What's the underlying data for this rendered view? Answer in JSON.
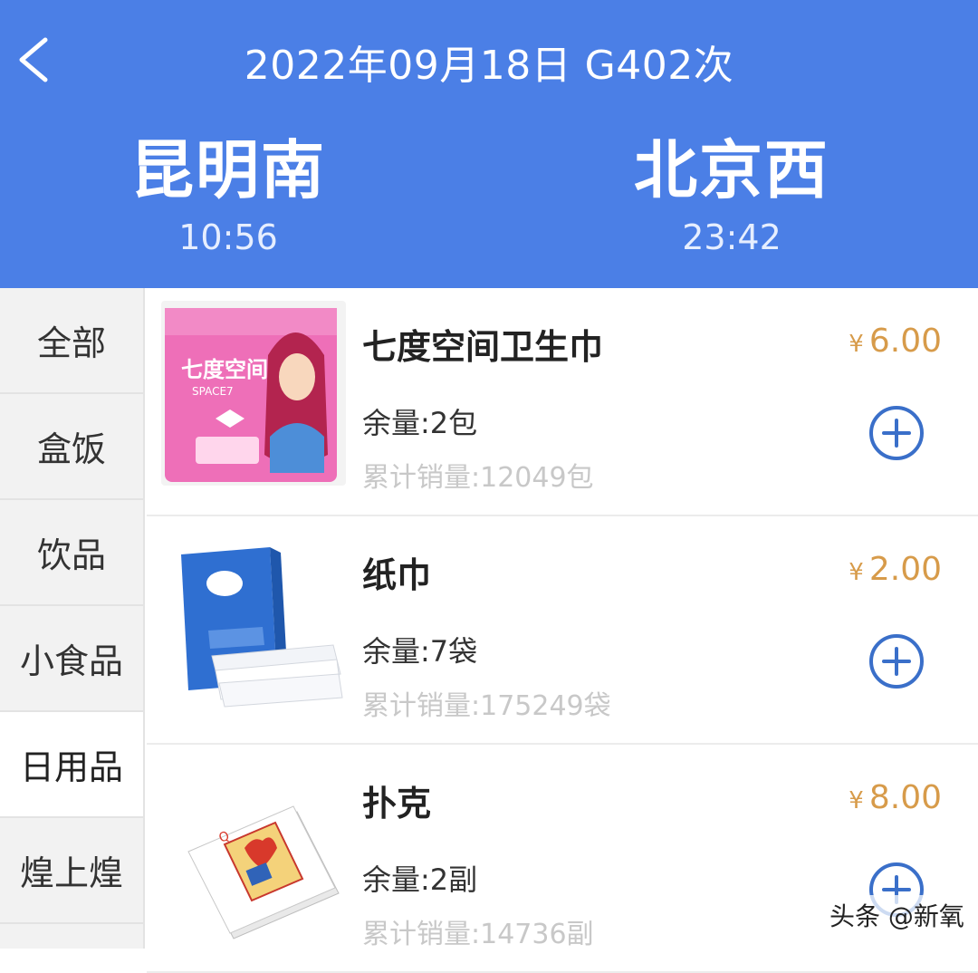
{
  "header": {
    "title": "2022年09月18日 G402次",
    "from_station": "昆明南",
    "to_station": "北京西",
    "depart_time": "10:56",
    "arrive_time": "23:42"
  },
  "sidebar": {
    "items": [
      {
        "label": "全部"
      },
      {
        "label": "盒饭"
      },
      {
        "label": "饮品"
      },
      {
        "label": "小食品"
      },
      {
        "label": "日用品"
      },
      {
        "label": "煌上煌"
      }
    ]
  },
  "products": [
    {
      "name": "七度空间卫生巾",
      "price_symbol": "¥",
      "price": "6.00",
      "stock": "余量:2包",
      "sold": "累计销量:12049包",
      "image": "sanitary-pad-package"
    },
    {
      "name": "纸巾",
      "price_symbol": "¥",
      "price": "2.00",
      "stock": "余量:7袋",
      "sold": "累计销量:175249袋",
      "image": "tissue-pack"
    },
    {
      "name": "扑克",
      "price_symbol": "¥",
      "price": "8.00",
      "stock": "余量:2副",
      "sold": "累计销量:14736副",
      "image": "playing-cards"
    }
  ],
  "watermark": "头条 @新氧",
  "colors": {
    "header_bg": "#4b7fe6",
    "price": "#d79b4a",
    "add_button": "#3a6fc9"
  }
}
